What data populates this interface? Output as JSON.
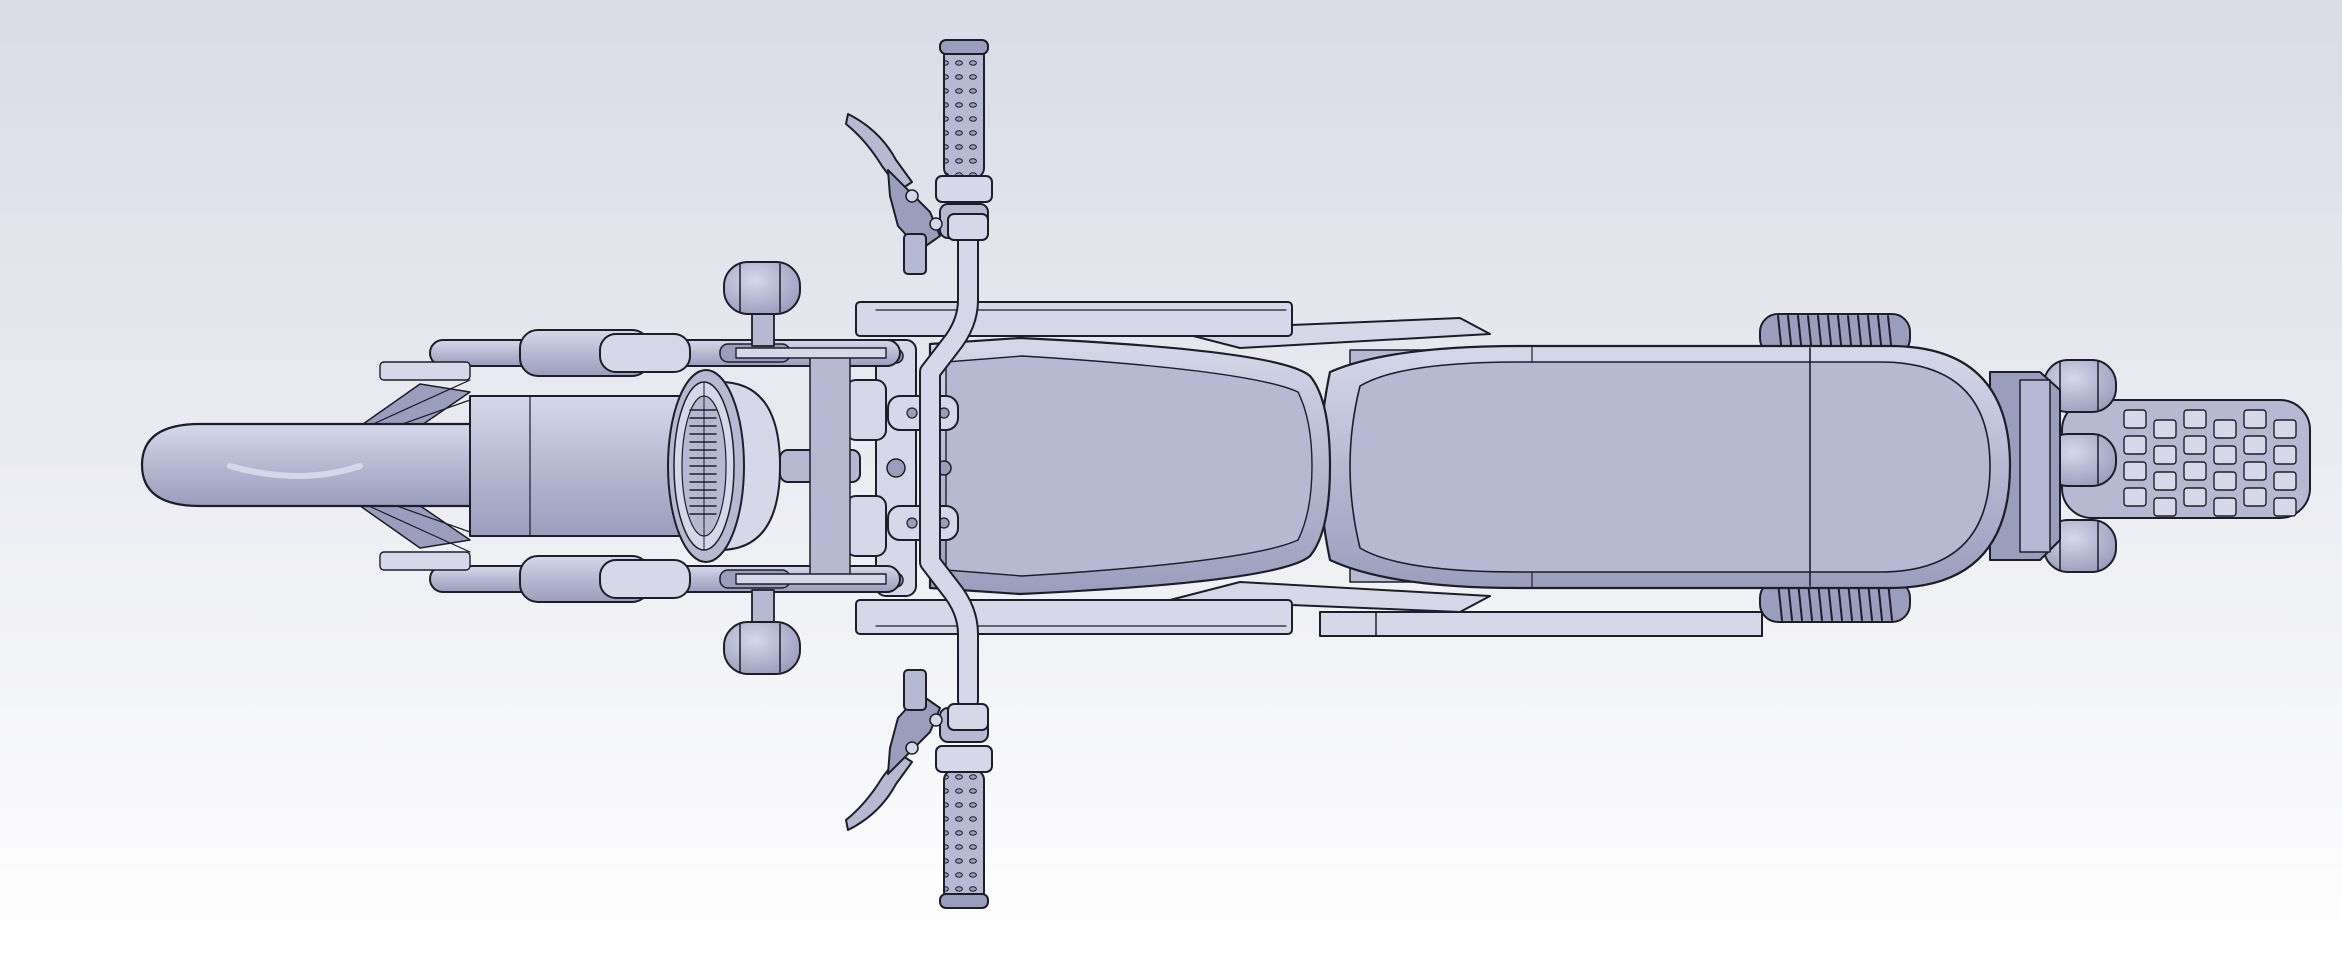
{
  "view": {
    "background_top": "#d9dbe6",
    "background_bottom": "#ffffff",
    "part_fill": "#b7b9d2",
    "part_fill_dark": "#9b9dbd",
    "part_fill_light": "#d6d8ea",
    "edge_color": "#1e1e2a"
  }
}
